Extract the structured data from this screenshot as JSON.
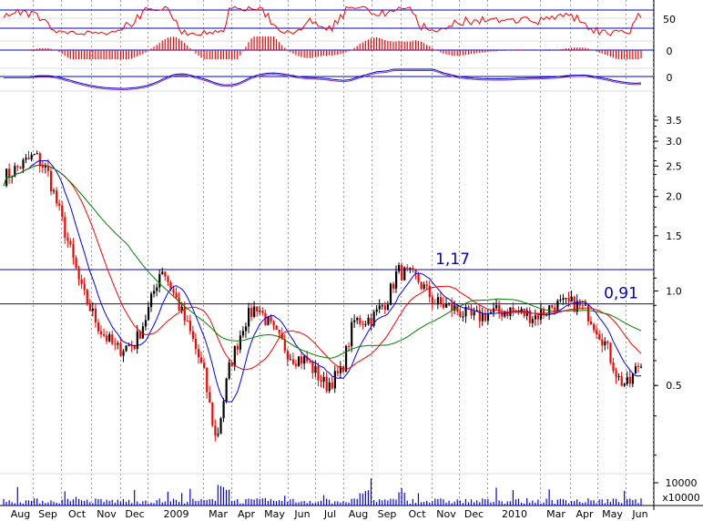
{
  "chart_data": {
    "type": "line",
    "subtype": "candlestick-with-indicators",
    "title": "",
    "y_scale": "log",
    "ylim": [
      0.25,
      4.2
    ],
    "y_ticks": [
      "3.5",
      "3.0",
      "2.5",
      "2.0",
      "1.5",
      "1.0",
      "0.5"
    ],
    "x_labels": [
      "Aug",
      "Sep",
      "Oct",
      "Nov",
      "Dec",
      "2009",
      "Mar",
      "Apr",
      "May",
      "Jun",
      "Jul",
      "Aug",
      "Sep",
      "Oct",
      "Nov",
      "Dec",
      "2010",
      "Mar",
      "Apr",
      "May",
      "Jun"
    ],
    "annotations": [
      {
        "label": "1,17",
        "value": 1.17,
        "color": "#0000cc"
      },
      {
        "label": "0,91",
        "value": 0.91,
        "color": "#0000cc"
      }
    ],
    "price_key_points": [
      {
        "x": 0,
        "price": 2.3
      },
      {
        "x": 1.0,
        "price": 2.7
      },
      {
        "x": 1.4,
        "price": 2.4
      },
      {
        "x": 2.0,
        "price": 1.5
      },
      {
        "x": 2.5,
        "price": 1.0
      },
      {
        "x": 3.1,
        "price": 0.75
      },
      {
        "x": 3.6,
        "price": 0.65
      },
      {
        "x": 4.2,
        "price": 0.68
      },
      {
        "x": 4.6,
        "price": 0.85
      },
      {
        "x": 5.05,
        "price": 1.2
      },
      {
        "x": 5.5,
        "price": 0.95
      },
      {
        "x": 6.0,
        "price": 0.72
      },
      {
        "x": 6.4,
        "price": 0.55
      },
      {
        "x": 6.8,
        "price": 0.33
      },
      {
        "x": 7.2,
        "price": 0.56
      },
      {
        "x": 7.7,
        "price": 0.8
      },
      {
        "x": 8.1,
        "price": 0.9
      },
      {
        "x": 8.6,
        "price": 0.75
      },
      {
        "x": 9.2,
        "price": 0.62
      },
      {
        "x": 9.7,
        "price": 0.6
      },
      {
        "x": 10.3,
        "price": 0.5
      },
      {
        "x": 10.8,
        "price": 0.55
      },
      {
        "x": 11.2,
        "price": 0.8
      },
      {
        "x": 11.8,
        "price": 0.82
      },
      {
        "x": 12.3,
        "price": 0.95
      },
      {
        "x": 12.6,
        "price": 1.16
      },
      {
        "x": 13.2,
        "price": 1.1
      },
      {
        "x": 13.8,
        "price": 0.92
      },
      {
        "x": 14.4,
        "price": 0.88
      },
      {
        "x": 15.0,
        "price": 0.82
      },
      {
        "x": 15.6,
        "price": 0.85
      },
      {
        "x": 16.2,
        "price": 0.87
      },
      {
        "x": 17.0,
        "price": 0.83
      },
      {
        "x": 17.6,
        "price": 0.9
      },
      {
        "x": 18.3,
        "price": 0.91
      },
      {
        "x": 18.7,
        "price": 0.85
      },
      {
        "x": 19.2,
        "price": 0.7
      },
      {
        "x": 19.7,
        "price": 0.52
      },
      {
        "x": 20.0,
        "price": 0.5
      },
      {
        "x": 20.3,
        "price": 0.58
      }
    ],
    "moving_averages": [
      {
        "color": "#0000ff"
      },
      {
        "color": "#ff0000"
      },
      {
        "color": "#008000"
      }
    ],
    "rsi_panel": {
      "color": "#ff0000",
      "ticks": [
        "50",
        "0"
      ],
      "lines": [
        35,
        65
      ]
    },
    "macd_panel": {
      "color": "#ff0000",
      "tick": "0"
    },
    "osc_panel": {
      "color": "#0000cc",
      "tick": "0"
    },
    "volume_panel": {
      "color": "#0000ff",
      "ticks": [
        "10000",
        "x10000"
      ]
    }
  }
}
